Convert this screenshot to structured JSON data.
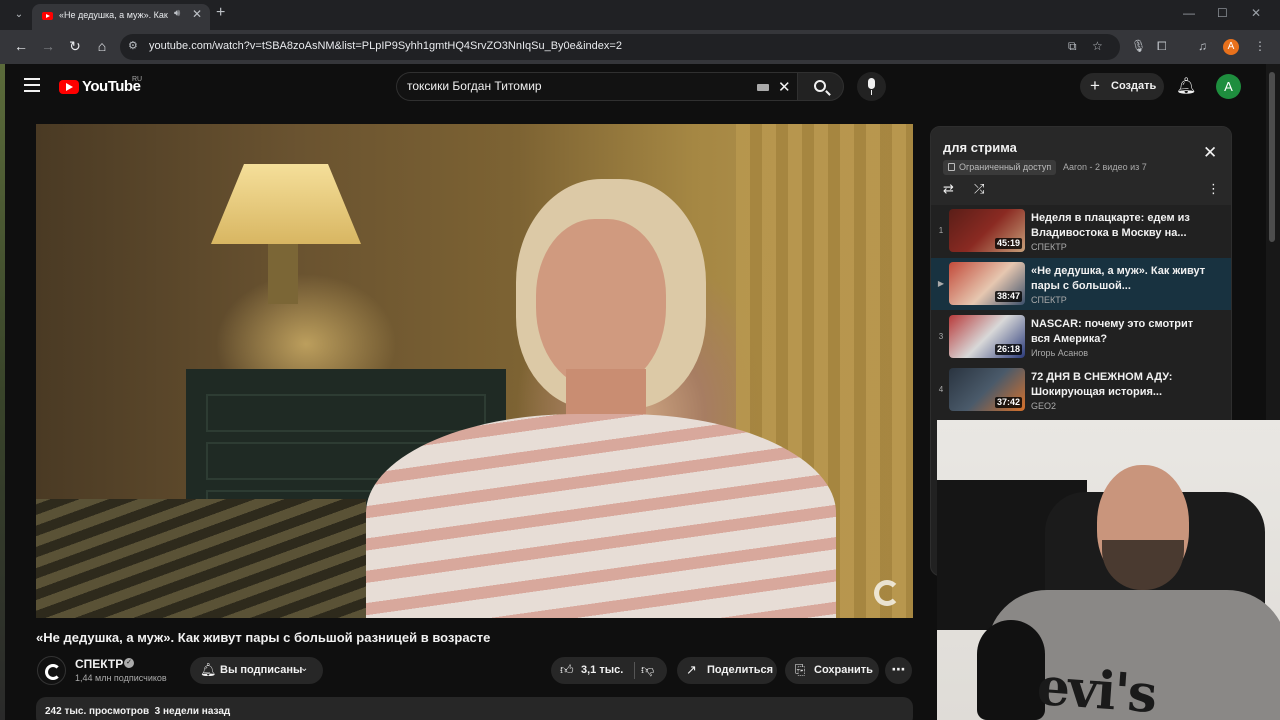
{
  "browser": {
    "tab_title": "«Не дедушка, а муж». Как",
    "url": "youtube.com/watch?v=tSBA8zoAsNM&list=PLpIP9Syhh1gmtHQ4SrvZO3NnIqSu_By0e&index=2",
    "profile_initial": "A"
  },
  "header": {
    "logo_text": "YouTube",
    "region": "RU",
    "search_value": "токсики Богдан Титомир",
    "create_label": "Создать",
    "avatar_initial": "A"
  },
  "video": {
    "title": "«Не дедушка, а муж». Как живут пары с большой разницей в возрасте",
    "channel": "СПЕКТР",
    "subscribers": "1,44 млн подписчиков",
    "subscribe_label": "Вы подписаны",
    "likes": "3,1 тыс.",
    "share_label": "Поделиться",
    "save_label": "Сохранить",
    "views": "242 тыс. просмотров",
    "age": "3 недели назад"
  },
  "playlist": {
    "title": "для стрима",
    "access": "Ограниченный доступ",
    "meta": "Aaron - 2 видео из 7",
    "items": [
      {
        "index": "1",
        "title": "Неделя в плацкарте: едем из Владивостока в Москву на...",
        "channel": "СПЕКТР",
        "duration": "45:19",
        "thumb_color": "#8a2a22"
      },
      {
        "index": "▶",
        "title": "«Не дедушка, а муж». Как живут пары с большой...",
        "channel": "СПЕКТР",
        "duration": "38:47",
        "thumb_color": "#c24a3a"
      },
      {
        "index": "3",
        "title": "NASCAR: почему это смотрит вся Америка?",
        "channel": "Игорь Асанов",
        "duration": "26:18",
        "thumb_color": "#b83a3a"
      },
      {
        "index": "4",
        "title": "72 ДНЯ В СНЕЖНОМ АДУ: Шокирующая история...",
        "channel": "GEO2",
        "duration": "37:42",
        "thumb_color": "#4a5a6a"
      }
    ]
  },
  "colors": {
    "accent_red": "#ff0000",
    "active_row": "#183240",
    "background": "#0f0f0f"
  }
}
